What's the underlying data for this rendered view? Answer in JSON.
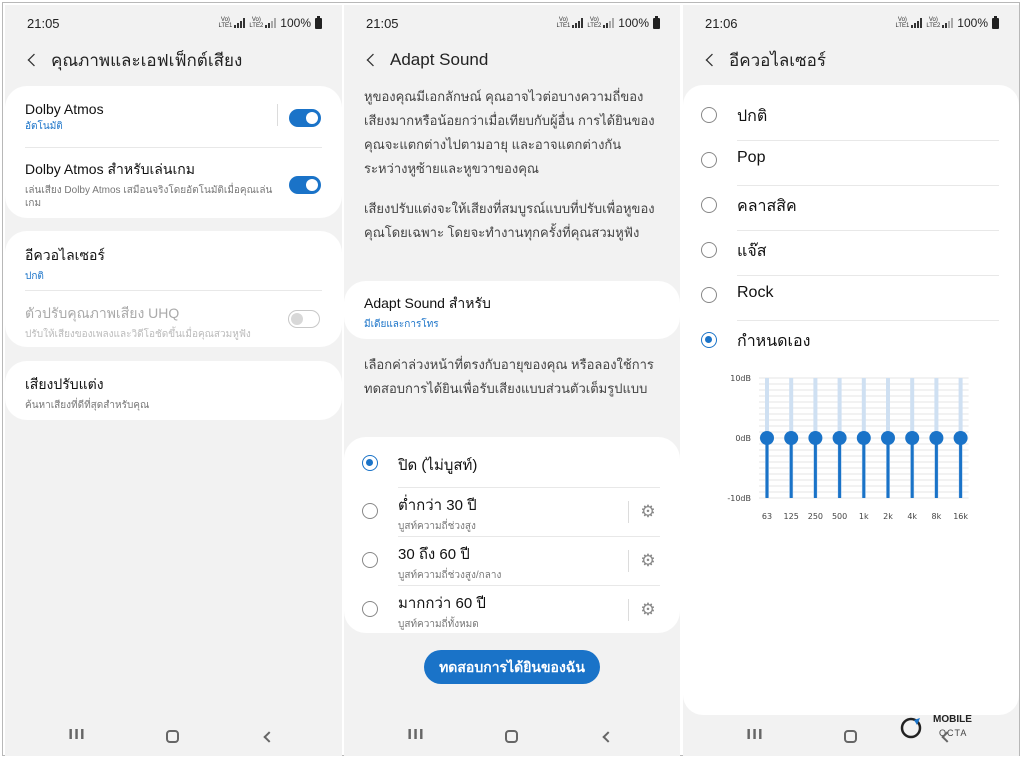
{
  "status": {
    "p1_time": "21:05",
    "p2_time": "21:05",
    "p3_time": "21:06",
    "battery": "100%",
    "sig1": "Vo) LTE1",
    "sig2": "Vo) LTE2"
  },
  "panel1": {
    "title": "คุณภาพและเอฟเฟ็กต์เสียง",
    "dolby_title": "Dolby Atmos",
    "dolby_sub": "อัตโนมัติ",
    "dolby_game_title": "Dolby Atmos สำหรับเล่นเกม",
    "dolby_game_sub": "เล่นเสียง Dolby Atmos เสมือนจริงโดยอัตโนมัติเมื่อคุณเล่นเกม",
    "eq_title": "อีควอไลเซอร์",
    "eq_sub": "ปกติ",
    "uhq_title": "ตัวปรับคุณภาพเสียง UHQ",
    "uhq_sub": "ปรับให้เสียงของเพลงและวิดีโอชัดขึ้นเมื่อคุณสวมหูฟัง",
    "adapt_title": "เสียงปรับแต่ง",
    "adapt_sub": "ค้นหาเสียงที่ดีที่สุดสำหรับคุณ"
  },
  "panel2": {
    "title": "Adapt Sound",
    "para1": "หูของคุณมีเอกลักษณ์ คุณอาจไวต่อบางความถี่ของเสียงมากหรือน้อยกว่าเมื่อเทียบกับผู้อื่น การได้ยินของคุณจะแตกต่างไปตามอายุ และอาจแตกต่างกันระหว่างหูซ้ายและหูขวาของคุณ",
    "para2": "เสียงปรับแต่งจะให้เสียงที่สมบูรณ์แบบที่ปรับเพื่อหูของคุณโดยเฉพาะ โดยจะทำงานทุกครั้งที่คุณสวมหูฟัง",
    "adapt_for_title": "Adapt Sound สำหรับ",
    "adapt_for_sub": "มีเดียและการโทร",
    "para3": "เลือกค่าล่วงหน้าที่ตรงกับอายุของคุณ หรือลองใช้การทดสอบการได้ยินเพื่อรับเสียงแบบส่วนตัวเต็มรูปแบบ",
    "options": [
      {
        "label": "ปิด (ไม่บูสท์)",
        "sub": ""
      },
      {
        "label": "ต่ำกว่า 30 ปี",
        "sub": "บูสท์ความถี่ช่วงสูง"
      },
      {
        "label": "30 ถึง 60 ปี",
        "sub": "บูสท์ความถี่ช่วงสูง/กลาง"
      },
      {
        "label": "มากกว่า 60 ปี",
        "sub": "บูสท์ความถี่ทั้งหมด"
      }
    ],
    "selected_option": 0,
    "test_button": "ทดสอบการได้ยินของฉัน"
  },
  "panel3": {
    "title": "อีควอไลเซอร์",
    "presets": [
      "ปกติ",
      "Pop",
      "คลาสสิค",
      "แจ๊ส",
      "Rock",
      "กำหนดเอง"
    ],
    "selected_preset": 5
  },
  "chart_data": {
    "type": "bar",
    "categories": [
      "63",
      "125",
      "250",
      "500",
      "1k",
      "2k",
      "4k",
      "8k",
      "16k"
    ],
    "values": [
      0,
      0,
      0,
      0,
      0,
      0,
      0,
      0,
      0
    ],
    "y_ticks": [
      "10dB",
      "0dB",
      "-10dB"
    ],
    "ylim": [
      -10,
      10
    ],
    "grid": true,
    "accent": "#1a73c8"
  },
  "watermark": {
    "line1": "MOBILE",
    "line2": "OCTA"
  },
  "colors": {
    "accent": "#1a73c8",
    "background": "#f2f2f2"
  }
}
